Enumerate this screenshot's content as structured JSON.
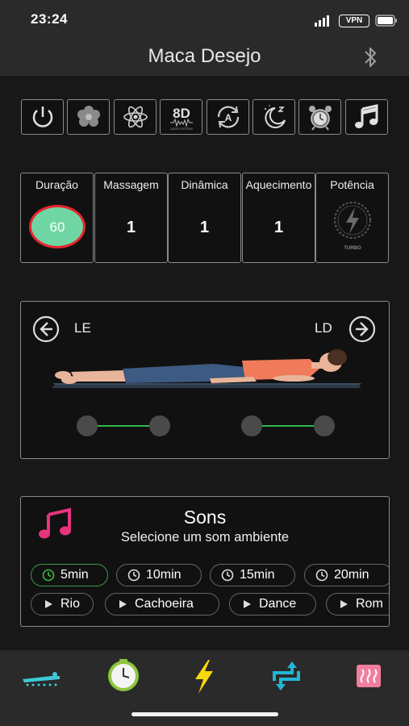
{
  "status": {
    "time": "23:24",
    "vpn": "VPN"
  },
  "nav": {
    "title": "Maca Desejo",
    "right_icon": "bluetooth-icon"
  },
  "modes": [
    {
      "icon": "power-icon"
    },
    {
      "icon": "flower-icon"
    },
    {
      "icon": "atom-icon"
    },
    {
      "icon": "8d-audio-icon",
      "label": "8D",
      "sublabel": "AUDIO SYSTEM"
    },
    {
      "icon": "auto-rotate-icon",
      "label": "A"
    },
    {
      "icon": "sleep-moon-icon"
    },
    {
      "icon": "alarm-clock-icon"
    },
    {
      "icon": "music-note-icon"
    }
  ],
  "params": {
    "duration": {
      "label": "Duração",
      "value": "60"
    },
    "massage": {
      "label": "Massagem",
      "value": "1"
    },
    "dynamic": {
      "label": "Dinâmica",
      "value": "1"
    },
    "heating": {
      "label": "Aquecimento",
      "value": "1"
    },
    "power": {
      "label": "Potência",
      "badge": "TURBO"
    }
  },
  "body_panel": {
    "left_label": "LE",
    "right_label": "LD"
  },
  "sounds": {
    "title": "Sons",
    "subtitle": "Selecione um som ambiente",
    "durations": [
      {
        "label": "5min",
        "active": true
      },
      {
        "label": "10min",
        "active": false
      },
      {
        "label": "15min",
        "active": false
      },
      {
        "label": "20min",
        "active": false
      }
    ],
    "tracks": [
      {
        "label": "Rio"
      },
      {
        "label": "Cachoeira"
      },
      {
        "label": "Dance"
      },
      {
        "label": "Rom"
      }
    ]
  },
  "tabs": [
    {
      "icon": "massage-table-icon"
    },
    {
      "icon": "clock-icon"
    },
    {
      "icon": "lightning-icon"
    },
    {
      "icon": "swap-arrows-icon"
    },
    {
      "icon": "heat-icon"
    }
  ],
  "colors": {
    "accent_green": "#6fd6a3",
    "accent_red": "#e8242e",
    "accent_yellow": "#f5d90a",
    "accent_cyan": "#1fb6d6",
    "music_pink": "#e8337f",
    "heat_pink": "#f07ea0"
  }
}
